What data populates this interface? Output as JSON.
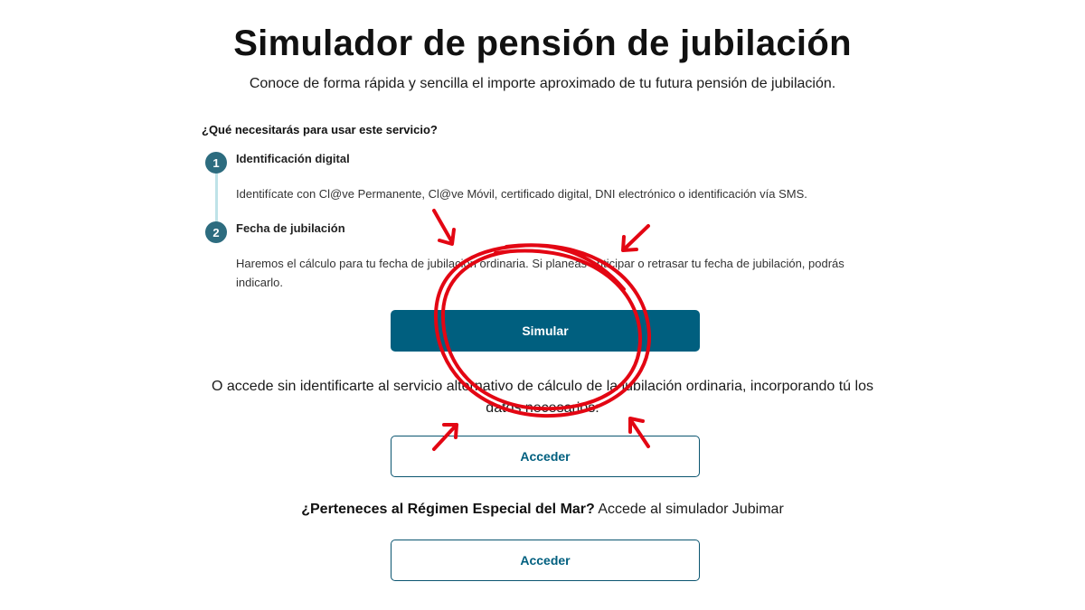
{
  "header": {
    "title": "Simulador de pensión de jubilación",
    "subtitle": "Conoce de forma rápida y sencilla el importe aproximado de tu futura pensión de jubilación."
  },
  "requirements": {
    "heading": "¿Qué necesitarás para usar este servicio?",
    "steps": [
      {
        "number": "1",
        "title": "Identificación digital",
        "text": "Identifícate con Cl@ve Permanente, Cl@ve Móvil, certificado digital, DNI electrónico o identificación vía SMS."
      },
      {
        "number": "2",
        "title": "Fecha de jubilación",
        "text": "Haremos el cálculo para tu fecha de jubilación ordinaria. Si planeas anticipar o retrasar tu fecha de jubilación, podrás indicarlo."
      }
    ]
  },
  "actions": {
    "simulate_label": "Simular",
    "alternative_text": "O accede sin identificarte al servicio alternativo de cálculo de la jubilación ordinaria, incorporando tú los datos necesarios:",
    "access_label": "Acceder"
  },
  "mar": {
    "question": "¿Perteneces al Régimen Especial del Mar?",
    "text": " Accede al simulador Jubimar",
    "access_label": "Acceder"
  },
  "colors": {
    "primary": "#005f7f",
    "step_badge": "#2d6c7f",
    "annotation": "#e30613"
  }
}
